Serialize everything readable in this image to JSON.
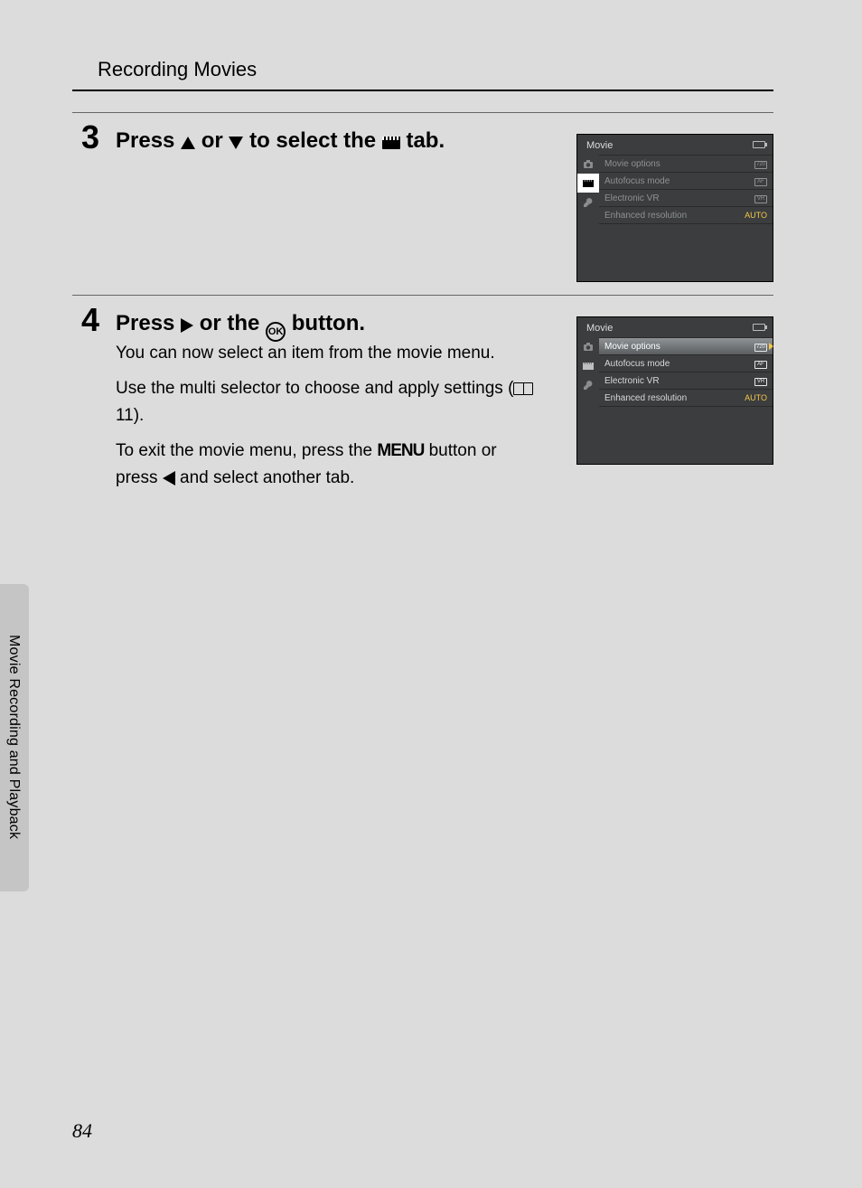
{
  "header": {
    "title": "Recording Movies"
  },
  "side": {
    "title": "Movie Recording and Playback"
  },
  "pageNumber": "84",
  "steps": {
    "s3": {
      "num": "3",
      "head_a": "Press ",
      "head_b": " or ",
      "head_c": " to select the ",
      "head_d": " tab."
    },
    "s4": {
      "num": "4",
      "head_a": "Press ",
      "head_b": " or the ",
      "head_c": " button.",
      "p1": "You can now select an item from the movie menu.",
      "p2a": "Use the multi selector to choose and apply settings (",
      "p2ref": " 11",
      "p2b": ").",
      "p3a": "To exit the movie menu, press the ",
      "p3menu": "MENU",
      "p3b": " button or press ",
      "p3c": " and select another tab."
    }
  },
  "lcd": {
    "title": "Movie",
    "rows": [
      {
        "label": "Movie options",
        "value": "720",
        "vtype": "icon"
      },
      {
        "label": "Autofocus mode",
        "value": "AF",
        "vtype": "icon"
      },
      {
        "label": "Electronic VR",
        "value": "VR",
        "vtype": "icon"
      },
      {
        "label": "Enhanced resolution",
        "value": "AUTO",
        "vtype": "text"
      }
    ]
  }
}
